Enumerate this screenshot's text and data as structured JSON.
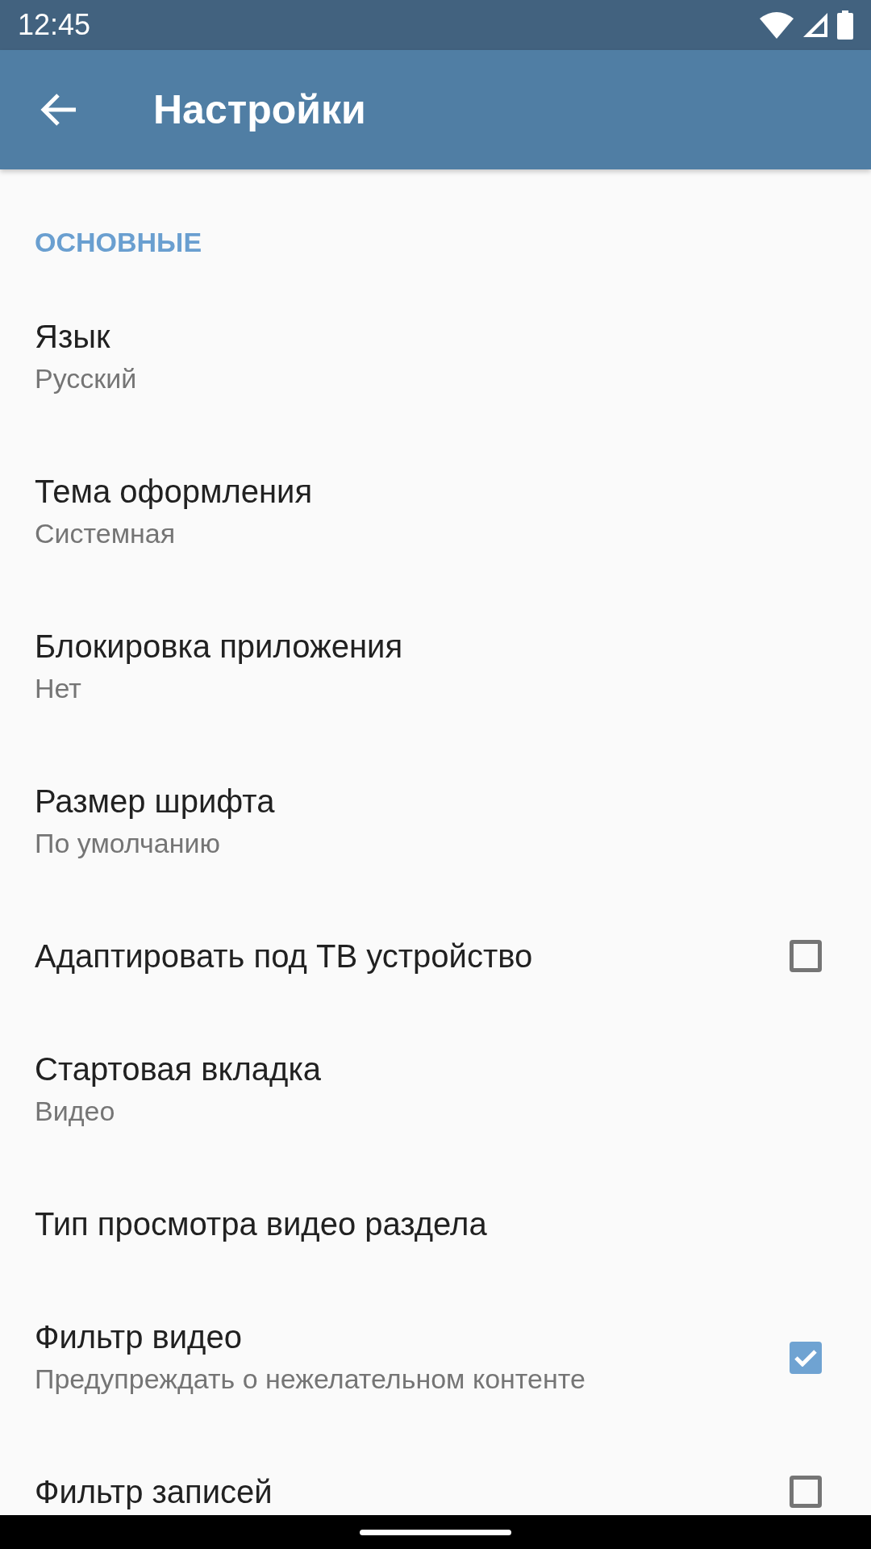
{
  "status_bar": {
    "time": "12:45"
  },
  "app_bar": {
    "title": "Настройки"
  },
  "sections": [
    {
      "header": "ОСНОВНЫЕ",
      "items": [
        {
          "kind": "text",
          "title": "Язык",
          "subtitle": "Русский"
        },
        {
          "kind": "text",
          "title": "Тема оформления",
          "subtitle": "Системная"
        },
        {
          "kind": "text",
          "title": "Блокировка приложения",
          "subtitle": "Нет"
        },
        {
          "kind": "text",
          "title": "Размер шрифта",
          "subtitle": "По умолчанию"
        },
        {
          "kind": "checkbox",
          "title": "Адаптировать под ТВ устройство",
          "checked": false
        },
        {
          "kind": "text",
          "title": "Стартовая вкладка",
          "subtitle": "Видео"
        },
        {
          "kind": "text",
          "title": "Тип просмотра видео раздела"
        },
        {
          "kind": "checkbox",
          "title": "Фильтр видео",
          "subtitle": "Предупреждать о нежелательном контенте",
          "checked": true
        },
        {
          "kind": "checkbox",
          "title": "Фильтр записей",
          "checked": false
        }
      ]
    }
  ]
}
